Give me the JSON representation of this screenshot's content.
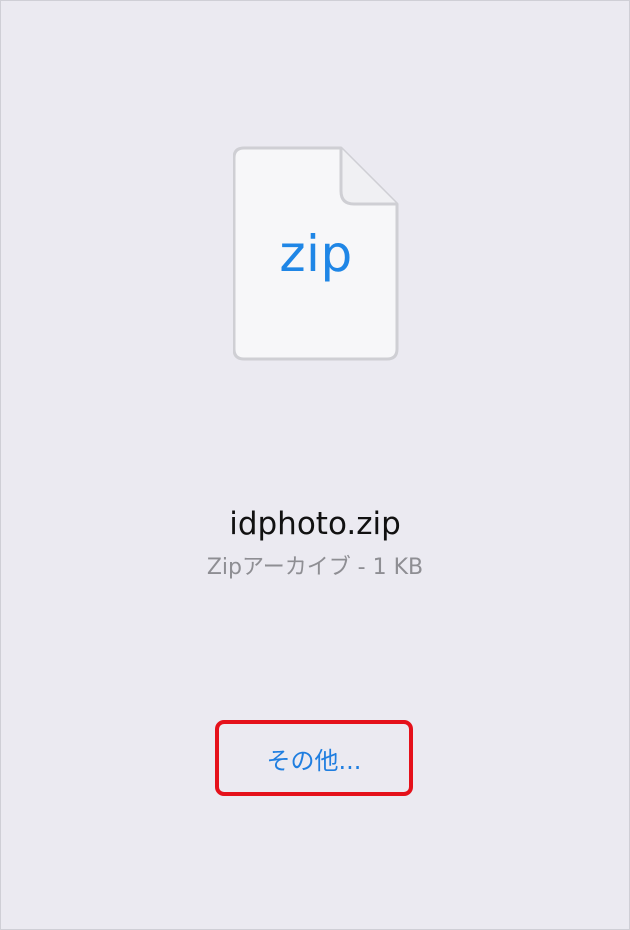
{
  "file": {
    "icon": "zip-file-icon",
    "extension_label": "zip",
    "name": "idphoto.zip",
    "meta": "Zipアーカイブ - 1 KB"
  },
  "actions": {
    "more_label": "その他..."
  },
  "colors": {
    "background": "#ebeaf1",
    "accent": "#1f86e6",
    "highlight": "#e5111b",
    "meta_text": "#8e8e93"
  }
}
